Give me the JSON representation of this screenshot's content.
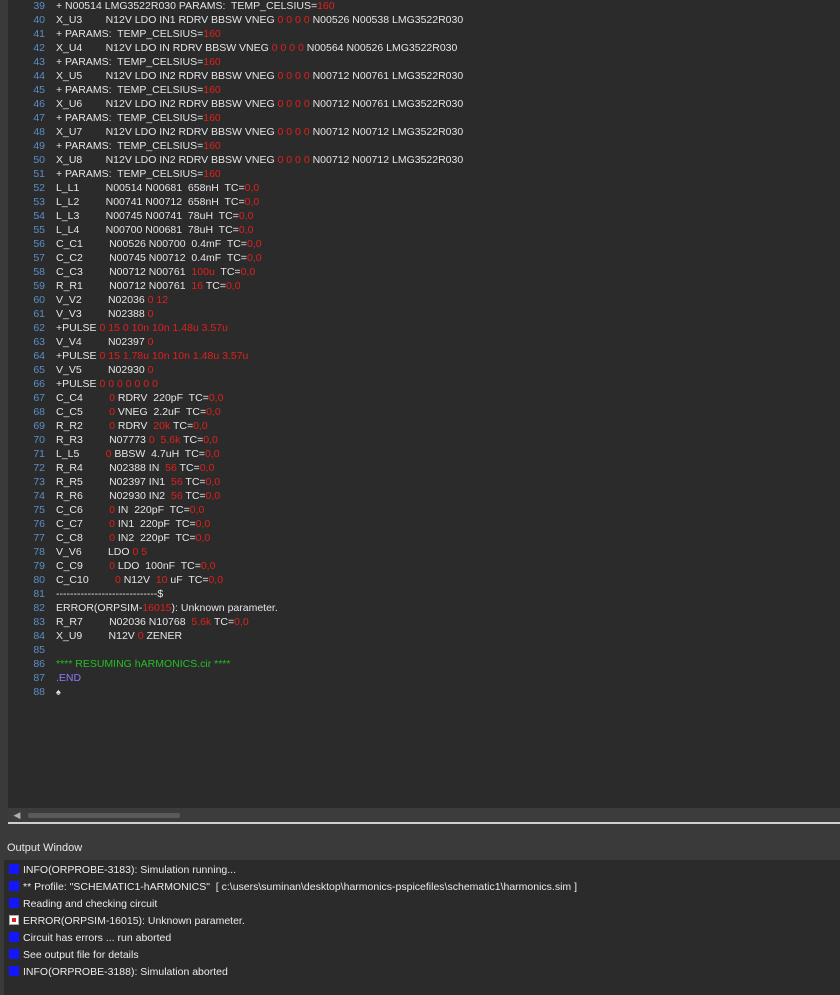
{
  "editor": {
    "lines": [
      {
        "n": "39",
        "t": [
          [
            "+ N00514 LMG3522R030 PARAMS:  TEMP_CELSIUS=",
            ""
          ],
          [
            "160",
            "num"
          ]
        ]
      },
      {
        "n": "40",
        "t": [
          [
            "X_U3        N12V LDO IN1 RDRV BBSW VNEG ",
            ""
          ],
          [
            "0 0 0 0",
            "num"
          ],
          [
            " N00526 N00538 LMG3522R030",
            ""
          ]
        ]
      },
      {
        "n": "41",
        "t": [
          [
            "+ PARAMS:  TEMP_CELSIUS=",
            ""
          ],
          [
            "160",
            "num"
          ]
        ]
      },
      {
        "n": "42",
        "t": [
          [
            "X_U4        N12V LDO IN RDRV BBSW VNEG ",
            ""
          ],
          [
            "0 0 0 0",
            "num"
          ],
          [
            " N00564 N00526 LMG3522R030",
            ""
          ]
        ]
      },
      {
        "n": "43",
        "t": [
          [
            "+ PARAMS:  TEMP_CELSIUS=",
            ""
          ],
          [
            "160",
            "num"
          ]
        ]
      },
      {
        "n": "44",
        "t": [
          [
            "X_U5        N12V LDO IN2 RDRV BBSW VNEG ",
            ""
          ],
          [
            "0 0 0 0",
            "num"
          ],
          [
            " N00712 N00761 LMG3522R030",
            ""
          ]
        ]
      },
      {
        "n": "45",
        "t": [
          [
            "+ PARAMS:  TEMP_CELSIUS=",
            ""
          ],
          [
            "160",
            "num"
          ]
        ]
      },
      {
        "n": "46",
        "t": [
          [
            "X_U6        N12V LDO IN2 RDRV BBSW VNEG ",
            ""
          ],
          [
            "0 0 0 0",
            "num"
          ],
          [
            " N00712 N00761 LMG3522R030",
            ""
          ]
        ]
      },
      {
        "n": "47",
        "t": [
          [
            "+ PARAMS:  TEMP_CELSIUS=",
            ""
          ],
          [
            "160",
            "num"
          ]
        ]
      },
      {
        "n": "48",
        "t": [
          [
            "X_U7        N12V LDO IN2 RDRV BBSW VNEG ",
            ""
          ],
          [
            "0 0 0 0",
            "num"
          ],
          [
            " N00712 N00712 LMG3522R030",
            ""
          ]
        ]
      },
      {
        "n": "49",
        "t": [
          [
            "+ PARAMS:  TEMP_CELSIUS=",
            ""
          ],
          [
            "160",
            "num"
          ]
        ]
      },
      {
        "n": "50",
        "t": [
          [
            "X_U8        N12V LDO IN2 RDRV BBSW VNEG ",
            ""
          ],
          [
            "0 0 0 0",
            "num"
          ],
          [
            " N00712 N00712 LMG3522R030",
            ""
          ]
        ]
      },
      {
        "n": "51",
        "t": [
          [
            "+ PARAMS:  TEMP_CELSIUS=",
            ""
          ],
          [
            "160",
            "num"
          ]
        ]
      },
      {
        "n": "52",
        "t": [
          [
            "L_L1         N00514 N00681  658nH  TC=",
            ""
          ],
          [
            "0,0",
            "num"
          ]
        ]
      },
      {
        "n": "53",
        "t": [
          [
            "L_L2         N00741 N00712  658nH  TC=",
            ""
          ],
          [
            "0,0",
            "num"
          ]
        ]
      },
      {
        "n": "54",
        "t": [
          [
            "L_L3         N00745 N00741  78uH  TC=",
            ""
          ],
          [
            "0,0",
            "num"
          ]
        ]
      },
      {
        "n": "55",
        "t": [
          [
            "L_L4         N00700 N00681  78uH  TC=",
            ""
          ],
          [
            "0,0",
            "num"
          ]
        ]
      },
      {
        "n": "56",
        "t": [
          [
            "C_C1         N00526 N00700  0.4mF  TC=",
            ""
          ],
          [
            "0,0",
            "num"
          ]
        ]
      },
      {
        "n": "57",
        "t": [
          [
            "C_C2         N00745 N00712  0.4mF  TC=",
            ""
          ],
          [
            "0,0",
            "num"
          ]
        ]
      },
      {
        "n": "58",
        "t": [
          [
            "C_C3         N00712 N00761  ",
            ""
          ],
          [
            "100u",
            "num"
          ],
          [
            "  TC=",
            ""
          ],
          [
            "0,0",
            "num"
          ]
        ]
      },
      {
        "n": "59",
        "t": [
          [
            "R_R1         N00712 N00761  ",
            ""
          ],
          [
            "16",
            "num"
          ],
          [
            " TC=",
            ""
          ],
          [
            "0,0",
            "num"
          ]
        ]
      },
      {
        "n": "60",
        "t": [
          [
            "V_V2         N02036 ",
            ""
          ],
          [
            "0 12",
            "num"
          ]
        ]
      },
      {
        "n": "61",
        "t": [
          [
            "V_V3         N02388 ",
            ""
          ],
          [
            "0",
            "num"
          ]
        ]
      },
      {
        "n": "62",
        "t": [
          [
            "+PULSE ",
            ""
          ],
          [
            "0 15 0 10n 10n 1.48u 3.57u",
            "num"
          ]
        ]
      },
      {
        "n": "63",
        "t": [
          [
            "V_V4         N02397 ",
            ""
          ],
          [
            "0",
            "num"
          ]
        ]
      },
      {
        "n": "64",
        "t": [
          [
            "+PULSE ",
            ""
          ],
          [
            "0 15 1.78u 10n 10n 1.48u 3.57u",
            "num"
          ]
        ]
      },
      {
        "n": "65",
        "t": [
          [
            "V_V5         N02930 ",
            ""
          ],
          [
            "0",
            "num"
          ]
        ]
      },
      {
        "n": "66",
        "t": [
          [
            "+PULSE ",
            ""
          ],
          [
            "0 0 0 0 0 0 0",
            "num"
          ]
        ]
      },
      {
        "n": "67",
        "t": [
          [
            "C_C4         ",
            ""
          ],
          [
            "0",
            "num"
          ],
          [
            " RDRV  220pF  TC=",
            ""
          ],
          [
            "0,0",
            "num"
          ]
        ]
      },
      {
        "n": "68",
        "t": [
          [
            "C_C5         ",
            ""
          ],
          [
            "0",
            "num"
          ],
          [
            " VNEG  2.2uF  TC=",
            ""
          ],
          [
            "0,0",
            "num"
          ]
        ]
      },
      {
        "n": "69",
        "t": [
          [
            "R_R2         ",
            ""
          ],
          [
            "0",
            "num"
          ],
          [
            " RDRV  ",
            ""
          ],
          [
            "20k",
            "num"
          ],
          [
            " TC=",
            ""
          ],
          [
            "0,0",
            "num"
          ]
        ]
      },
      {
        "n": "70",
        "t": [
          [
            "R_R3         N07773 ",
            ""
          ],
          [
            "0  5.6k",
            "num"
          ],
          [
            " TC=",
            ""
          ],
          [
            "0,0",
            "num"
          ]
        ]
      },
      {
        "n": "71",
        "t": [
          [
            "L_L5         ",
            ""
          ],
          [
            "0",
            "num"
          ],
          [
            " BBSW  4.7uH  TC=",
            ""
          ],
          [
            "0,0",
            "num"
          ]
        ]
      },
      {
        "n": "72",
        "t": [
          [
            "R_R4         N02388 IN  ",
            ""
          ],
          [
            "56",
            "num"
          ],
          [
            " TC=",
            ""
          ],
          [
            "0,0",
            "num"
          ]
        ]
      },
      {
        "n": "73",
        "t": [
          [
            "R_R5         N02397 IN1  ",
            ""
          ],
          [
            "56",
            "num"
          ],
          [
            " TC=",
            ""
          ],
          [
            "0,0",
            "num"
          ]
        ]
      },
      {
        "n": "74",
        "t": [
          [
            "R_R6         N02930 IN2  ",
            ""
          ],
          [
            "56",
            "num"
          ],
          [
            " TC=",
            ""
          ],
          [
            "0,0",
            "num"
          ]
        ]
      },
      {
        "n": "75",
        "t": [
          [
            "C_C6         ",
            ""
          ],
          [
            "0",
            "num"
          ],
          [
            " IN  220pF  TC=",
            ""
          ],
          [
            "0,0",
            "num"
          ]
        ]
      },
      {
        "n": "76",
        "t": [
          [
            "C_C7         ",
            ""
          ],
          [
            "0",
            "num"
          ],
          [
            " IN1  220pF  TC=",
            ""
          ],
          [
            "0,0",
            "num"
          ]
        ]
      },
      {
        "n": "77",
        "t": [
          [
            "C_C8         ",
            ""
          ],
          [
            "0",
            "num"
          ],
          [
            " IN2  220pF  TC=",
            ""
          ],
          [
            "0,0",
            "num"
          ]
        ]
      },
      {
        "n": "78",
        "t": [
          [
            "V_V6         LDO ",
            ""
          ],
          [
            "0 5",
            "num"
          ]
        ]
      },
      {
        "n": "79",
        "t": [
          [
            "C_C9         ",
            ""
          ],
          [
            "0",
            "num"
          ],
          [
            " LDO  100nF  TC=",
            ""
          ],
          [
            "0,0",
            "num"
          ]
        ]
      },
      {
        "n": "80",
        "t": [
          [
            "C_C10         ",
            ""
          ],
          [
            "0",
            "num"
          ],
          [
            " N12V  ",
            ""
          ],
          [
            "10",
            "num"
          ],
          [
            " uF  TC=",
            ""
          ],
          [
            "0,0",
            "num"
          ]
        ]
      },
      {
        "n": "81",
        "t": [
          [
            "-----------------------------$",
            ""
          ]
        ]
      },
      {
        "n": "82",
        "t": [
          [
            "ERROR(ORPSIM-",
            ""
          ],
          [
            "16015",
            "num"
          ],
          [
            "): Unknown parameter.",
            ""
          ]
        ]
      },
      {
        "n": "83",
        "t": [
          [
            "R_R7         N02036 N10768  ",
            ""
          ],
          [
            "5.6k",
            "num"
          ],
          [
            " TC=",
            ""
          ],
          [
            "0,0",
            "num"
          ]
        ]
      },
      {
        "n": "84",
        "t": [
          [
            "X_U9         N12V ",
            ""
          ],
          [
            "0",
            "num"
          ],
          [
            " ZENER",
            ""
          ]
        ]
      },
      {
        "n": "85",
        "t": []
      },
      {
        "n": "86",
        "t": [
          [
            "**** RESUMING hARMONICS.cir ****",
            "comment"
          ]
        ]
      },
      {
        "n": "87",
        "t": [
          [
            ".END",
            "kw"
          ]
        ]
      },
      {
        "n": "88",
        "t": [
          [
            "♠",
            "marker"
          ]
        ]
      }
    ],
    "scroll_left_glyph": "◀"
  },
  "output": {
    "title": "Output Window",
    "lines": [
      {
        "kind": "info",
        "text": "INFO(ORPROBE-3183): Simulation running..."
      },
      {
        "kind": "info",
        "text": "** Profile: \"SCHEMATIC1-hARMONICS\"  [ c:\\users\\suminan\\desktop\\harmonics-pspicefiles\\schematic1\\harmonics.sim ]"
      },
      {
        "kind": "info",
        "text": "Reading and checking circuit"
      },
      {
        "kind": "error",
        "text": "ERROR(ORPSIM-16015): Unknown parameter."
      },
      {
        "kind": "info",
        "text": "Circuit has errors ... run aborted"
      },
      {
        "kind": "info",
        "text": "See output file for details"
      },
      {
        "kind": "info",
        "text": "INFO(ORPROBE-3188): Simulation aborted"
      }
    ]
  }
}
